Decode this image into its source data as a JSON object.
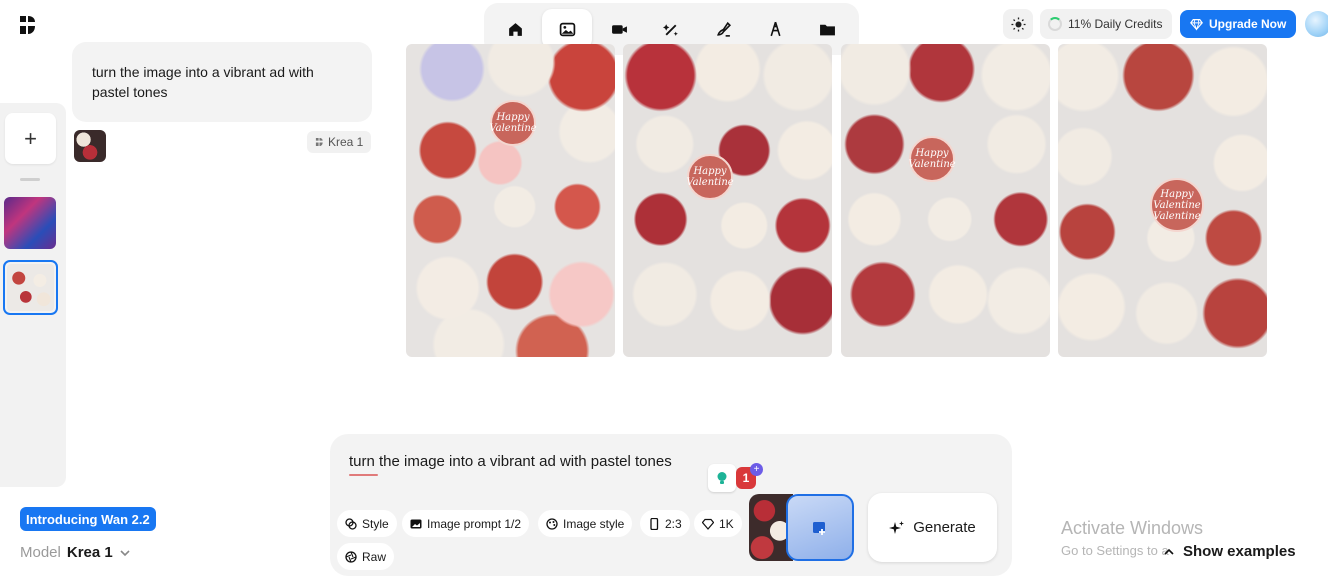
{
  "toolbar": {
    "items": [
      {
        "name": "home-icon",
        "active": false
      },
      {
        "name": "image-icon",
        "active": true
      },
      {
        "name": "video-icon",
        "active": false
      },
      {
        "name": "enhance-wand-icon",
        "active": false
      },
      {
        "name": "edit-brush-icon",
        "active": false
      },
      {
        "name": "text-pen-icon",
        "active": false
      },
      {
        "name": "folder-icon",
        "active": false
      }
    ]
  },
  "header": {
    "credits_label": "11% Daily Credits",
    "upgrade_label": "Upgrade Now"
  },
  "chat": {
    "prompt": "turn the image into a vibrant ad with pastel tones",
    "model_chip": "Krea 1"
  },
  "images": [
    {
      "label": "Happy Valentine"
    },
    {
      "label": "Happy Valentine"
    },
    {
      "label": "Happy Valentine"
    },
    {
      "label": "Happy Valentine Valentine"
    }
  ],
  "prompt_panel": {
    "text": "turn the image into a vibrant ad with pastel tones",
    "badge_count": "1",
    "pills": {
      "style": "Style",
      "image_prompt": "Image prompt 1/2",
      "image_style": "Image style",
      "aspect": "2:3",
      "resolution": "1K",
      "raw": "Raw"
    },
    "generate_label": "Generate"
  },
  "footer": {
    "intro_label": "Introducing Wan 2.2",
    "model_key": "Model",
    "model_value": "Krea 1",
    "watermark_title": "Activate Windows",
    "watermark_sub": "Go to Settings to a",
    "show_examples": "Show examples"
  },
  "colors": {
    "accent": "#1877f2",
    "panel": "#f3f3f3",
    "badge": "#d9383a"
  }
}
